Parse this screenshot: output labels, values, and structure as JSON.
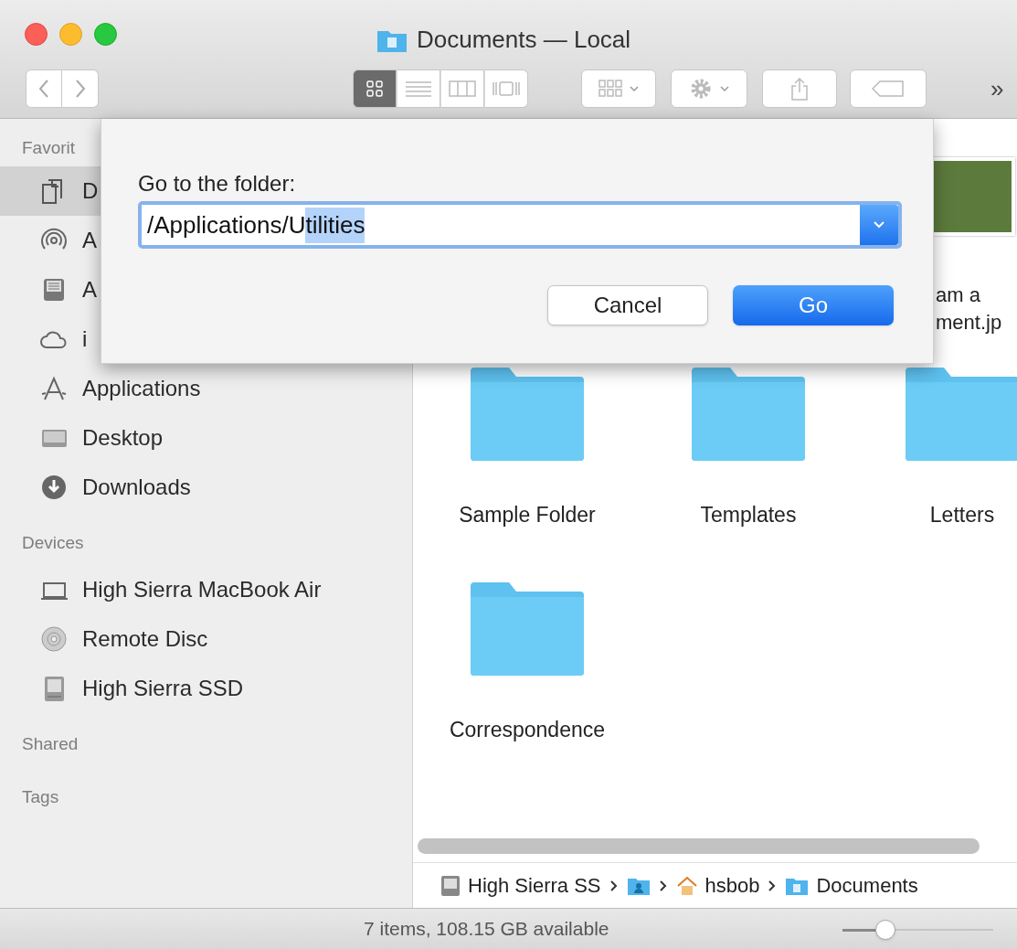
{
  "window": {
    "title": "Documents — Local"
  },
  "toolbar": {
    "view_modes": [
      {
        "kind": "icon",
        "selected": true
      },
      {
        "kind": "list",
        "selected": false
      },
      {
        "kind": "column",
        "selected": false
      },
      {
        "kind": "gallery",
        "selected": false
      }
    ],
    "overflow": "»"
  },
  "sidebar": {
    "sections": [
      {
        "heading": "Favorit",
        "items": [
          {
            "kind": "documents",
            "label": "D",
            "selected": true
          },
          {
            "kind": "airdrop",
            "label": "A",
            "selected": false
          },
          {
            "kind": "allfiles",
            "label": "A",
            "selected": false
          },
          {
            "kind": "cloud",
            "label": "i",
            "selected": false
          },
          {
            "kind": "applications",
            "label": "Applications",
            "selected": false
          },
          {
            "kind": "desktop",
            "label": "Desktop",
            "selected": false
          },
          {
            "kind": "downloads",
            "label": "Downloads",
            "selected": false
          }
        ]
      },
      {
        "heading": "Devices",
        "items": [
          {
            "kind": "laptop",
            "label": "High Sierra MacBook Air",
            "selected": false
          },
          {
            "kind": "disc",
            "label": "Remote Disc",
            "selected": false
          },
          {
            "kind": "drive",
            "label": "High Sierra SSD",
            "selected": false
          }
        ]
      },
      {
        "heading": "Shared"
      },
      {
        "heading": "Tags"
      }
    ]
  },
  "content": {
    "image_file": {
      "label_lines": [
        "am a",
        "ment.jp"
      ]
    },
    "folders": [
      {
        "name": "Sample Folder"
      },
      {
        "name": "Templates"
      },
      {
        "name": "Letters"
      },
      {
        "name": "Correspondence"
      }
    ]
  },
  "path_bar": [
    {
      "kind": "disk",
      "label": "High Sierra SS"
    },
    {
      "kind": "user-folder"
    },
    {
      "kind": "home",
      "label": "hsbob"
    },
    {
      "kind": "documents-folder",
      "label": "Documents"
    }
  ],
  "status_bar": {
    "text": "7 items, 108.15 GB available",
    "zoom": {
      "level": 0.25
    }
  },
  "dialog": {
    "label": "Go to the folder:",
    "field": {
      "segments": [
        {
          "text": "/Applications/U",
          "selected": false
        },
        {
          "text": "tilities",
          "selected": true
        }
      ]
    },
    "buttons": [
      {
        "kind": "secondary",
        "label": "Cancel"
      },
      {
        "kind": "default",
        "label": "Go"
      }
    ]
  }
}
